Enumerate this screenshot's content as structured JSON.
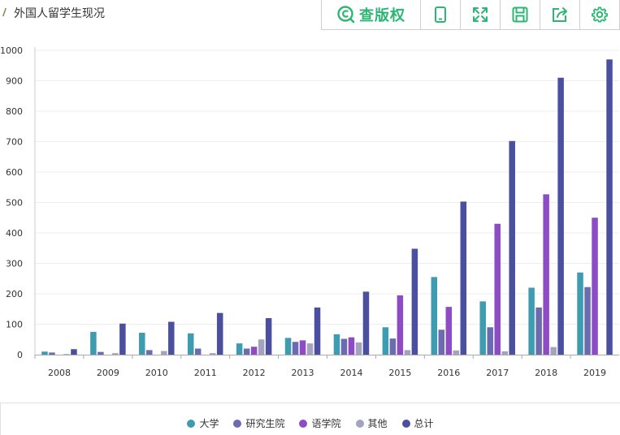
{
  "header": {
    "title": "外国人留学生现况"
  },
  "toolbar": {
    "brand_label": "查版权",
    "colors": {
      "accent": "#2bb673"
    },
    "icons": [
      "copyright-icon",
      "tablet-icon",
      "fullscreen-icon",
      "save-icon",
      "share-icon",
      "settings-icon"
    ]
  },
  "chart_data": {
    "type": "bar",
    "title": "",
    "xlabel": "",
    "ylabel": "",
    "ylim": [
      0,
      1000
    ],
    "yticks": [
      "0",
      "100",
      "200",
      "300",
      "400",
      "500",
      "600",
      "700",
      "800",
      "900",
      "1000"
    ],
    "grid": true,
    "legend_position": "bottom",
    "categories": [
      "2008",
      "2009",
      "2010",
      "2011",
      "2012",
      "2013",
      "2014",
      "2015",
      "2016",
      "2017",
      "2018",
      "2019"
    ],
    "series": [
      {
        "name": "大学",
        "color": "#3d9cb0",
        "values": [
          10,
          75,
          72,
          70,
          37,
          55,
          67,
          90,
          255,
          175,
          220,
          270
        ]
      },
      {
        "name": "研究生院",
        "color": "#6a6bb0",
        "values": [
          7,
          9,
          15,
          20,
          20,
          42,
          52,
          53,
          82,
          90,
          155,
          222
        ]
      },
      {
        "name": "语学院",
        "color": "#8e4cc4",
        "values": [
          0,
          0,
          0,
          0,
          26,
          47,
          57,
          195,
          157,
          430,
          527,
          450
        ]
      },
      {
        "name": "其他",
        "color": "#a3a3bf",
        "values": [
          2,
          5,
          12,
          5,
          50,
          37,
          40,
          15,
          14,
          11,
          25,
          0
        ]
      },
      {
        "name": "总计",
        "color": "#4a4fa0",
        "values": [
          18,
          102,
          108,
          137,
          120,
          155,
          207,
          348,
          503,
          702,
          910,
          970
        ]
      }
    ]
  }
}
